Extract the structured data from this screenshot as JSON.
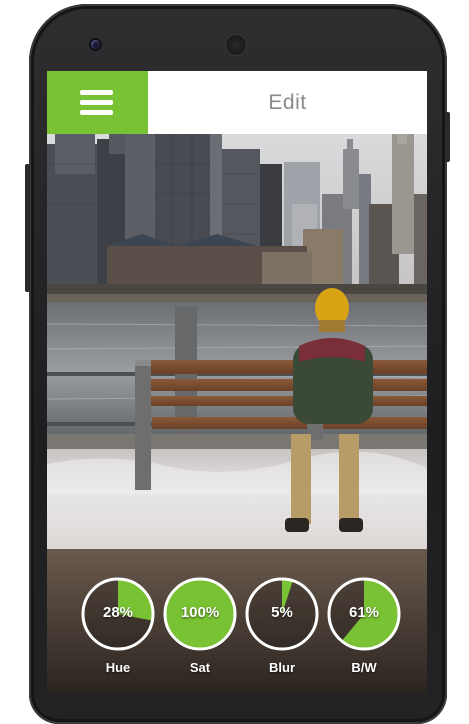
{
  "app": {
    "title": "Edit",
    "accent_color": "#79c233",
    "menu_icon": "hamburger-menu-icon"
  },
  "controls": [
    {
      "label": "Hue",
      "value": 28,
      "display": "28%",
      "fill": "#79c233"
    },
    {
      "label": "Sat",
      "value": 100,
      "display": "100%",
      "fill": "#79c233"
    },
    {
      "label": "Blur",
      "value": 5,
      "display": "5%",
      "fill": "#79c233"
    },
    {
      "label": "B/W",
      "value": 61,
      "display": "61%",
      "fill": "#79c233"
    }
  ]
}
